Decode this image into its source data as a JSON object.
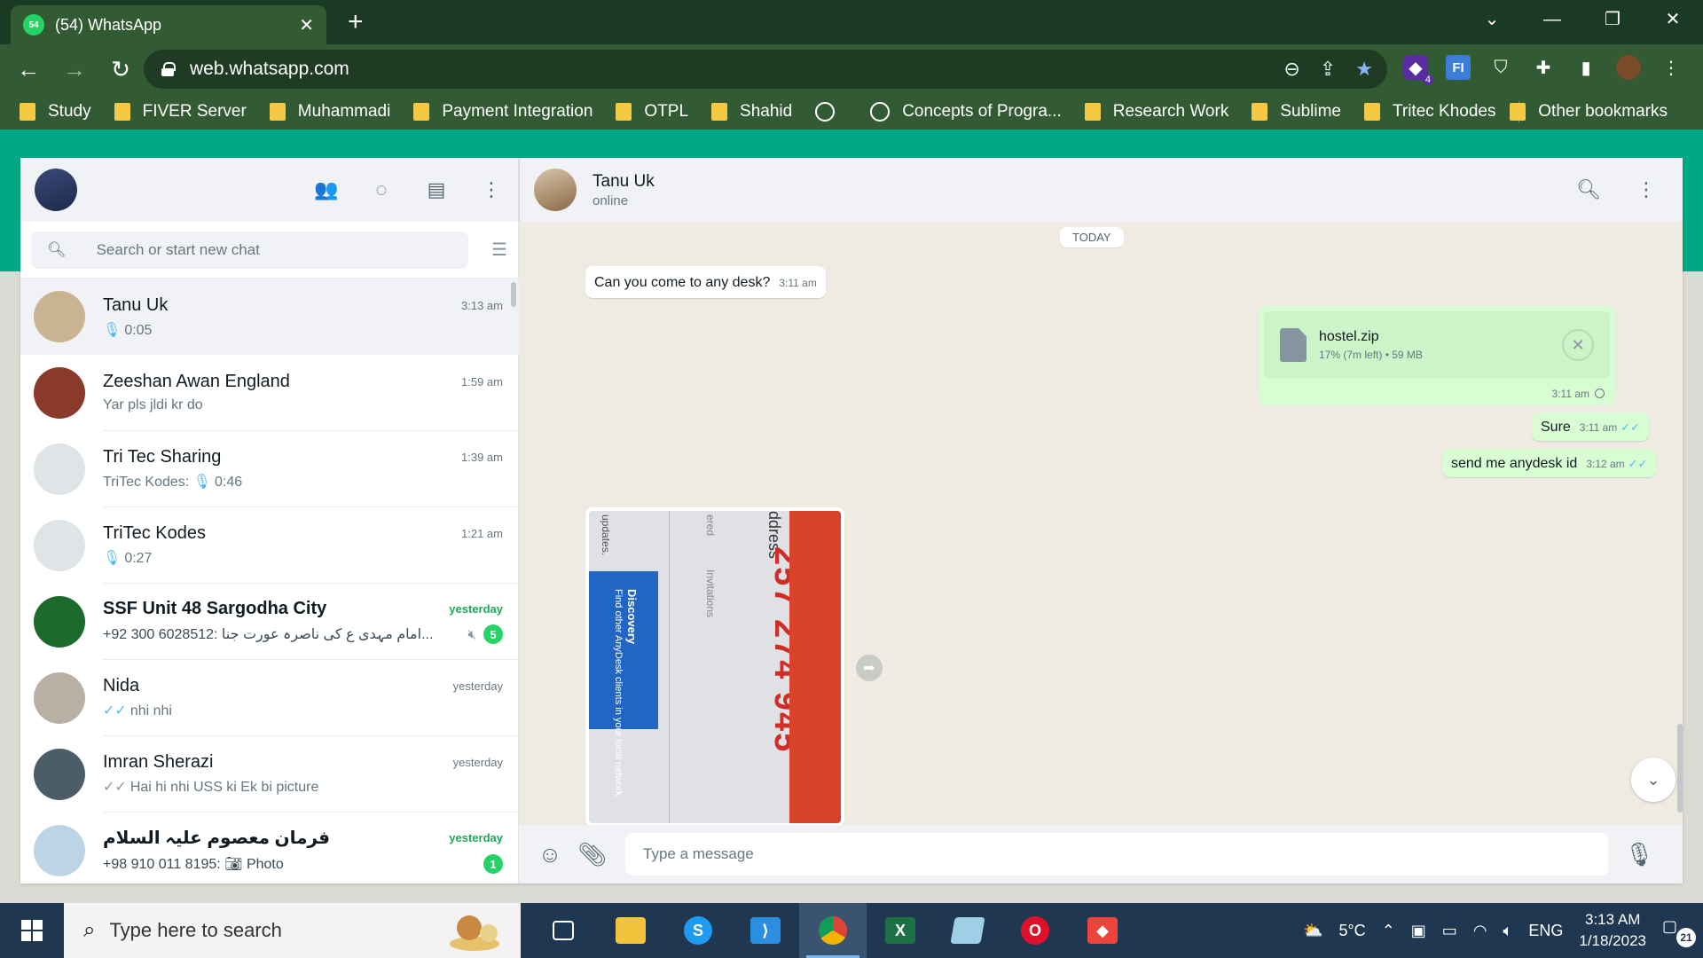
{
  "browser": {
    "tab_title": "(54) WhatsApp",
    "tab_favicon_badge": "54",
    "url": "web.whatsapp.com",
    "bookmarks": [
      "Study",
      "FIVER Server",
      "Muhammadi",
      "Payment Integration",
      "OTPL",
      "Shahid",
      "",
      "Concepts of Progra...",
      "Research Work",
      "Sublime",
      "Tritec Khodes"
    ],
    "other_bookmarks": "Other bookmarks",
    "extension_badge": "4",
    "ext_fi_label": "FI"
  },
  "sidebar": {
    "search_placeholder": "Search or start new chat",
    "chats": [
      {
        "name": "Tanu Uk",
        "time": "3:13 am",
        "preview": "0:05",
        "avatar_color": "#c9b392"
      },
      {
        "name": "Zeeshan Awan England",
        "time": "1:59 am",
        "preview": "Yar pls jldi kr do",
        "avatar_color": "#8a3a2a"
      },
      {
        "name": "Tri Tec Sharing",
        "time": "1:39 am",
        "preview_prefix": "TriTec Kodes: ",
        "preview": "0:46",
        "avatar_color": "#dfe5e7"
      },
      {
        "name": "TriTec Kodes",
        "time": "1:21 am",
        "preview": "0:27",
        "avatar_color": "#dfe5e7"
      },
      {
        "name": "SSF Unit 48 Sargodha City",
        "time": "yesterday",
        "preview": "+92 300 6028512:  امام مہدی ع کی ناصرہ عورت جنا...",
        "unread": "5",
        "avatar_color": "#1d6b2c"
      },
      {
        "name": "Nida",
        "time": "yesterday",
        "preview": "nhi nhi",
        "avatar_color": "#b8b0a4"
      },
      {
        "name": "Imran Sherazi",
        "time": "yesterday",
        "preview": "Hai hi nhi USS ki Ek bi picture",
        "avatar_color": "#4c5d6a"
      },
      {
        "name": "فرمان معصوم علیہ السلام",
        "time": "yesterday",
        "preview_prefix": "+98 910 011 8195: ",
        "preview": "Photo",
        "unread": "1",
        "avatar_color": "#bcd5e6"
      }
    ]
  },
  "conversation": {
    "name": "Tanu Uk",
    "status": "online",
    "date_chip": "TODAY",
    "messages": {
      "m1_text": "Can you come to any desk?",
      "m1_time": "3:11 am",
      "file_name": "hostel.zip",
      "file_meta": "17% (7m left) • 59 MB",
      "file_time": "3:11 am",
      "m3_text": "Sure",
      "m3_time": "3:11 am",
      "m4_text": "send me anydesk id",
      "m4_time": "3:12 am"
    },
    "photo": {
      "anydesk_address": "257 274 945",
      "discovery": "Discovery",
      "discovery_desc": "Find other AnyDesk clients in your local network",
      "addr_label": "ddress",
      "updates_label": "updates.",
      "invitations_label": "Invitations",
      "ered_label": "ered"
    },
    "composer_placeholder": "Type a message"
  },
  "taskbar": {
    "search_placeholder": "Type here to search",
    "weather": "5°C",
    "language": "ENG",
    "time": "3:13 AM",
    "date": "1/18/2023",
    "notifications": "21"
  },
  "colors": {
    "whatsapp_green": "#00a884",
    "outgoing_bubble": "#d9fdd3",
    "unread_badge": "#25d366"
  }
}
